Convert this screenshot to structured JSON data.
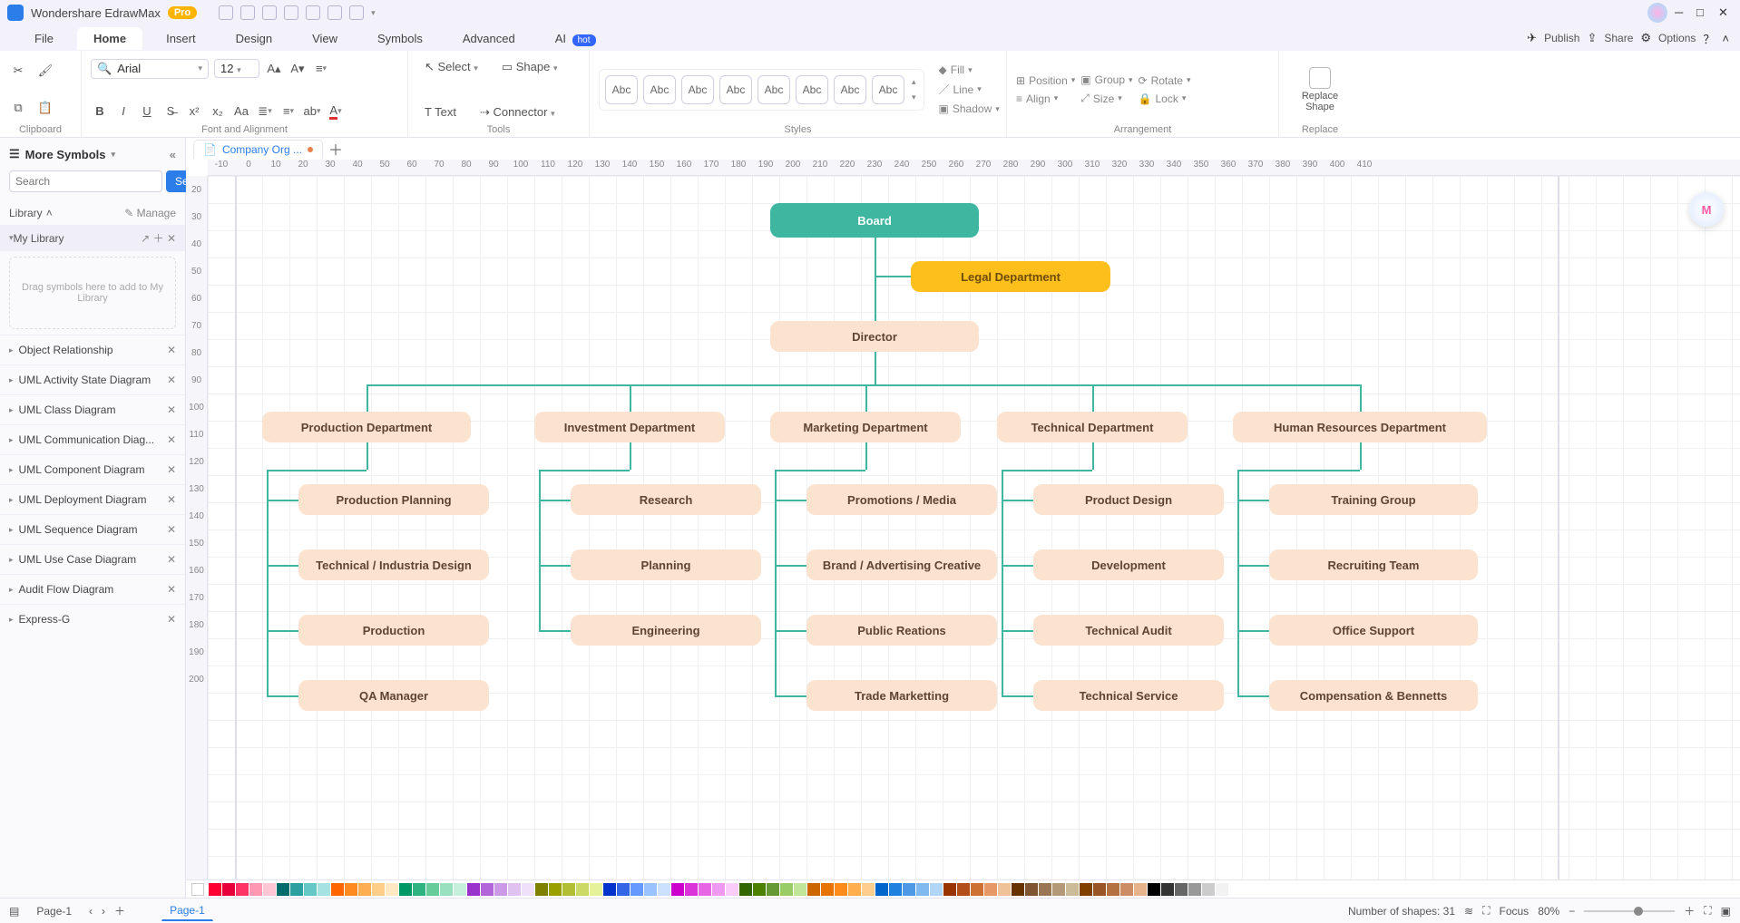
{
  "app": {
    "name": "Wondershare EdrawMax",
    "badge": "Pro"
  },
  "menu": {
    "tabs": [
      "File",
      "Home",
      "Insert",
      "Design",
      "View",
      "Symbols",
      "Advanced",
      "AI"
    ],
    "active": "Home",
    "hot_badge": "hot",
    "publish": "Publish",
    "share": "Share",
    "options": "Options"
  },
  "ribbon": {
    "clipboard_cap": "Clipboard",
    "font_name": "Arial",
    "font_size": "12",
    "font_cap": "Font and Alignment",
    "select": "Select",
    "text": "Text",
    "shape": "Shape",
    "connector": "Connector",
    "tools_cap": "Tools",
    "abc": "Abc",
    "styles_cap": "Styles",
    "fill": "Fill",
    "line": "Line",
    "shadow": "Shadow",
    "position": "Position",
    "align": "Align",
    "group": "Group",
    "size": "Size",
    "rotate": "Rotate",
    "lock": "Lock",
    "arr_cap": "Arrangement",
    "replace": "Replace Shape",
    "replace_cap": "Replace"
  },
  "sidebar": {
    "title": "More Symbols",
    "search_ph": "Search",
    "search_btn": "Search",
    "library_lbl": "Library",
    "manage": "Manage",
    "mylib": "My Library",
    "drop": "Drag symbols here to add to My Library",
    "cats": [
      "Object Relationship",
      "UML Activity State Diagram",
      "UML Class Diagram",
      "UML Communication Diag...",
      "UML Component Diagram",
      "UML Deployment Diagram",
      "UML Sequence Diagram",
      "UML Use Case Diagram",
      "Audit Flow Diagram",
      "Express-G"
    ]
  },
  "doc_tab": "Company Org ...",
  "ruler_h": [
    "-10",
    "0",
    "10",
    "20",
    "30",
    "40",
    "50",
    "60",
    "70",
    "80",
    "90",
    "100",
    "110",
    "120",
    "130",
    "140",
    "150",
    "160",
    "170",
    "180",
    "190",
    "200",
    "210",
    "220",
    "230",
    "240",
    "250",
    "260",
    "270",
    "280",
    "290",
    "300",
    "310",
    "320",
    "330",
    "340",
    "350",
    "360",
    "370",
    "380",
    "390",
    "400",
    "410"
  ],
  "ruler_v": [
    "20",
    "30",
    "40",
    "50",
    "60",
    "70",
    "80",
    "90",
    "100",
    "110",
    "120",
    "130",
    "140",
    "150",
    "160",
    "170",
    "180",
    "190",
    "200"
  ],
  "chart_data": {
    "type": "org-chart",
    "root": "Board",
    "staff": "Legal  Department",
    "child_of_root": "Director",
    "departments": [
      {
        "name": "Production Department",
        "items": [
          "Production Planning",
          "Technical / Industria Design",
          "Production",
          "QA Manager"
        ]
      },
      {
        "name": "Investment Department",
        "items": [
          "Research",
          "Planning",
          "Engineering"
        ]
      },
      {
        "name": "Marketing Department",
        "items": [
          "Promotions / Media",
          "Brand / Advertising Creative",
          "Public Reations",
          "Trade Marketting"
        ]
      },
      {
        "name": "Technical Department",
        "items": [
          "Product Design",
          "Development",
          "Technical Audit",
          "Technical Service"
        ]
      },
      {
        "name": "Human Resources Department",
        "items": [
          "Training Group",
          "Recruiting Team",
          "Office Support",
          "Compensation & Bennetts"
        ]
      }
    ]
  },
  "status": {
    "page_lbl": "Page-1",
    "page_tab": "Page-1",
    "shapes": "Number of shapes: 31",
    "focus": "Focus",
    "zoom": "80%"
  },
  "colors": [
    "#ff0033",
    "#e8003a",
    "#ff3366",
    "#ff99b3",
    "#ffc7d6",
    "#006b6b",
    "#2aa0a0",
    "#66c7c7",
    "#a6e2e2",
    "#ff6600",
    "#ff8a1f",
    "#ffad52",
    "#ffcf8a",
    "#ffe8c2",
    "#009966",
    "#2fb380",
    "#66cc99",
    "#99e0bf",
    "#c7f0dc",
    "#9933cc",
    "#b266d9",
    "#cc99e6",
    "#e0c2f0",
    "#f0e0f9",
    "#808000",
    "#99a000",
    "#b3bf33",
    "#ccd966",
    "#e6f299",
    "#0033cc",
    "#3366e6",
    "#6699ff",
    "#99c2ff",
    "#cce0ff",
    "#cc00cc",
    "#d933d9",
    "#e666e6",
    "#f099f0",
    "#f9ccf9",
    "#336600",
    "#4d8000",
    "#669933",
    "#99cc66",
    "#c2e699",
    "#cc6600",
    "#e67300",
    "#ff8c1a",
    "#ffad4d",
    "#ffce8c",
    "#0066cc",
    "#1f80e0",
    "#4d99e6",
    "#80b8f0",
    "#b3d6f7",
    "#993300",
    "#b34d1a",
    "#cc7033",
    "#e69966",
    "#f0c299",
    "#663300",
    "#805533",
    "#997755",
    "#b39977",
    "#ccbb99",
    "#804000",
    "#995526",
    "#b37040",
    "#cc8c66",
    "#e6b38c",
    "#000000",
    "#333333",
    "#666666",
    "#999999",
    "#cccccc",
    "#f2f2f2"
  ]
}
